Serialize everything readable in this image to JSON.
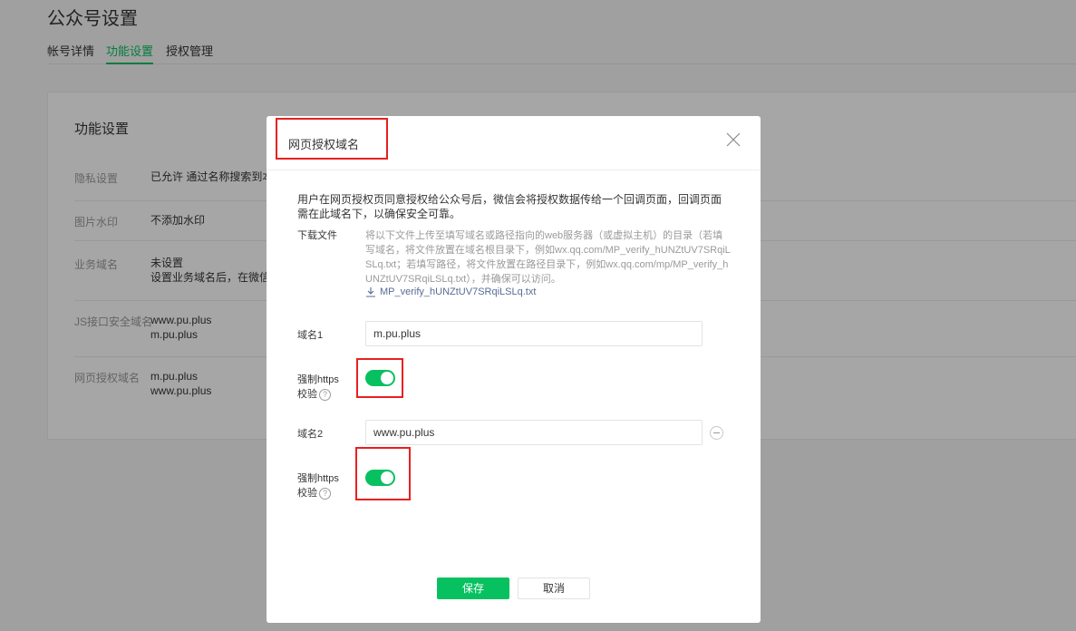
{
  "page": {
    "title": "公众号设置",
    "tabs": [
      "帐号详情",
      "功能设置",
      "授权管理"
    ],
    "active_tab": 1
  },
  "card": {
    "title": "功能设置",
    "rows": [
      {
        "label": "隐私设置",
        "lines": [
          "已允许 通过名称搜索到本帐"
        ]
      },
      {
        "label": "图片水印",
        "lines": [
          "不添加水印"
        ]
      },
      {
        "label": "业务域名",
        "lines": [
          "未设置",
          "设置业务域名后，在微信内访"
        ]
      },
      {
        "label": "JS接口安全域名",
        "lines": [
          "www.pu.plus",
          "m.pu.plus"
        ]
      },
      {
        "label": "网页授权域名",
        "lines": [
          "m.pu.plus",
          "www.pu.plus"
        ]
      }
    ]
  },
  "dialog": {
    "title": "网页授权域名",
    "description": "用户在网页授权页同意授权给公众号后，微信会将授权数据传给一个回调页面，回调页面需在此域名下，以确保安全可靠。",
    "download_label": "下载文件",
    "download_text": "将以下文件上传至填写域名或路径指向的web服务器（或虚拟主机）的目录（若填写域名，将文件放置在域名根目录下，例如wx.qq.com/MP_verify_hUNZtUV7SRqiLSLq.txt；若填写路径，将文件放置在路径目录下，例如wx.qq.com/mp/MP_verify_hUNZtUV7SRqiLSLq.txt），并确保可以访问。",
    "download_file": "MP_verify_hUNZtUV7SRqiLSLq.txt",
    "domain1_label": "域名1",
    "domain1_value": "m.pu.plus",
    "https1_label": "强制https",
    "https1_label2": "校验",
    "https1_on": true,
    "domain2_label": "域名2",
    "domain2_value": "www.pu.plus",
    "https2_label": "强制https",
    "https2_label2": "校验",
    "https2_on": true,
    "help_glyph": "?",
    "save_label": "保存",
    "cancel_label": "取消"
  },
  "colors": {
    "accent": "#07c160",
    "link": "#576b95",
    "highlight": "#e82020"
  }
}
